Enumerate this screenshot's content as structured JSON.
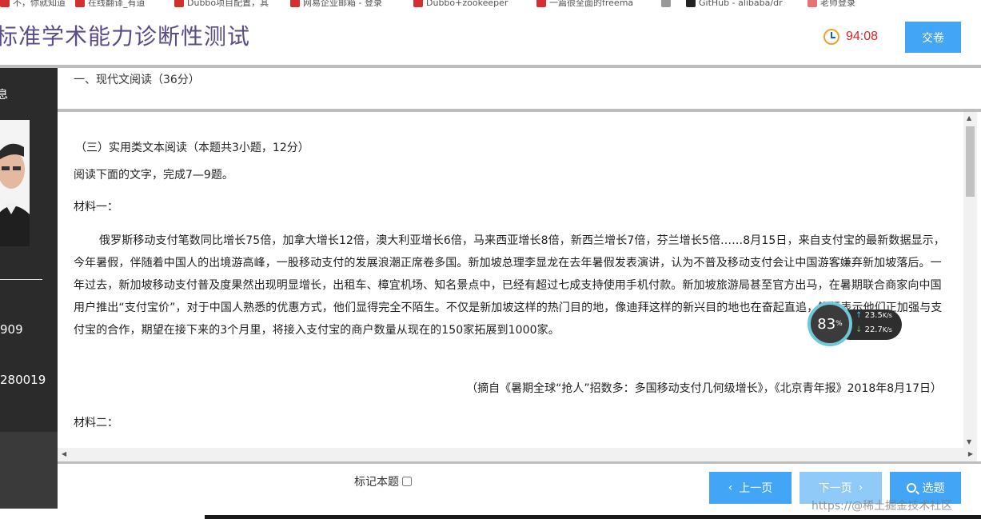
{
  "bookmarks": [
    {
      "label": "不，你就知道",
      "color": "#d32f2f"
    },
    {
      "label": "在线翻译_有道",
      "color": "#d32f2f"
    },
    {
      "label": "Dubbo项目配置，其",
      "color": "#d32f2f"
    },
    {
      "label": "网易企业邮箱 - 登录",
      "color": "#d32f2f"
    },
    {
      "label": "Dubbo+zookeeper",
      "color": "#d32f2f"
    },
    {
      "label": "一篇很全面的freema",
      "color": "#d32f2f"
    },
    {
      "label": "",
      "color": "#999999"
    },
    {
      "label": "GitHub - alibaba/dr",
      "color": "#222222"
    },
    {
      "label": "老师登录",
      "color": "#e57373"
    }
  ],
  "header": {
    "title": "标准学术能力诊断性测试",
    "timer": "94:08",
    "submit_label": "交卷"
  },
  "sidebar": {
    "label_top": "息",
    "field_a": "：",
    "value_a": "909",
    "field_b": "：",
    "value_b": "280019",
    "field_c": "："
  },
  "section": {
    "title": "一、现代文阅读（36分）"
  },
  "content": {
    "subtitle": "（三）实用类文本阅读（本题共3小题，12分）",
    "instruction": "阅读下面的文字，完成7—9题。",
    "material1": "材料一：",
    "body": "俄罗斯移动支付笔数同比增长75倍，加拿大增长12倍，澳大利亚增长6倍，马来西亚增长8倍，新西兰增长7倍，芬兰增长5倍……8月15日，来自支付宝的最新数据显示，今年暑假，伴随着中国人的出境游高峰，一股移动支付的发展浪潮正席卷多国。新加坡总理李显龙在去年暑假发表演讲，认为不普及移动支付会让中国游客嫌弃新加坡落后。一年过去，新加坡移动支付普及度果然出现明显增长，出租车、樟宜机场、知名景点中，已经有超过七成支持使用手机付款。新加坡旅游局甚至官方出马，在暑期联合商家向中国用户推出“支付宝价”，对于中国人熟悉的优惠方式，他们显得完全不陌生。不仅是新加坡这样的热门目的地，像迪拜这样的新兴目的地也在奋起直追，银行表示他们正加强与支付宝的合作，期望在接下来的3个月里，将接入支付宝的商户数量从现在的150家拓展到1000家。",
    "source": "（摘自《暑期全球“抢人”招数多：多国移动支付几何级增长》，《北京青年报》2018年8月17日）",
    "material2": "材料二："
  },
  "footer": {
    "mark_label": "标记本题",
    "prev_label": "上一页",
    "next_label": "下一页",
    "pick_label": "选题"
  },
  "net_widget": {
    "percent": "83",
    "percent_unit": "%",
    "upload": "23.5",
    "download": "22.7",
    "unit": "K/s"
  },
  "watermark": "https://@稀土掘金技术社区"
}
